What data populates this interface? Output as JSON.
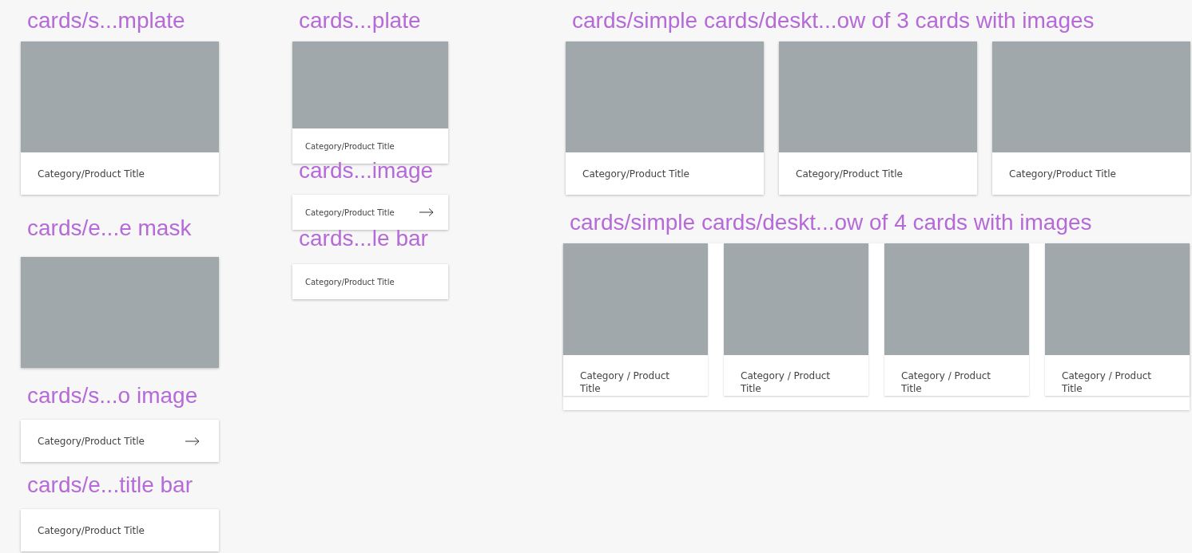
{
  "frames": [
    {
      "label": "cards/s...mplate",
      "cards": [
        {
          "kind": "image",
          "title": "Category/Product Title"
        }
      ]
    },
    {
      "label": "cards/e...e mask",
      "cards": [
        {
          "kind": "mask"
        }
      ]
    },
    {
      "label": "cards/s...o image",
      "cards": [
        {
          "kind": "arrow",
          "title": "Category/Product Title"
        }
      ]
    },
    {
      "label": "cards/e...title bar",
      "cards": [
        {
          "kind": "plain",
          "title": "Category/Product Title"
        }
      ]
    },
    {
      "label": "cards...plate",
      "cards": [
        {
          "kind": "image",
          "title": "Category/Product Title"
        }
      ]
    },
    {
      "label": "cards...image",
      "cards": [
        {
          "kind": "arrow",
          "title": "Category/Product Title"
        }
      ]
    },
    {
      "label": "cards...le bar",
      "cards": [
        {
          "kind": "plain",
          "title": "Category/Product Title"
        }
      ]
    },
    {
      "label": "cards/simple cards/deskt...ow of 3 cards with images",
      "cards": [
        {
          "kind": "image",
          "title": "Category/Product Title"
        },
        {
          "kind": "image",
          "title": "Category/Product Title"
        },
        {
          "kind": "image",
          "title": "Category/Product Title"
        }
      ]
    },
    {
      "label": "cards/simple cards/deskt...ow of 4 cards with images",
      "cards": [
        {
          "kind": "image",
          "title": "Category / Product Title"
        },
        {
          "kind": "image",
          "title": "Category / Product Title"
        },
        {
          "kind": "image",
          "title": "Category / Product Title"
        },
        {
          "kind": "image",
          "title": "Category / Product Title"
        }
      ]
    }
  ]
}
